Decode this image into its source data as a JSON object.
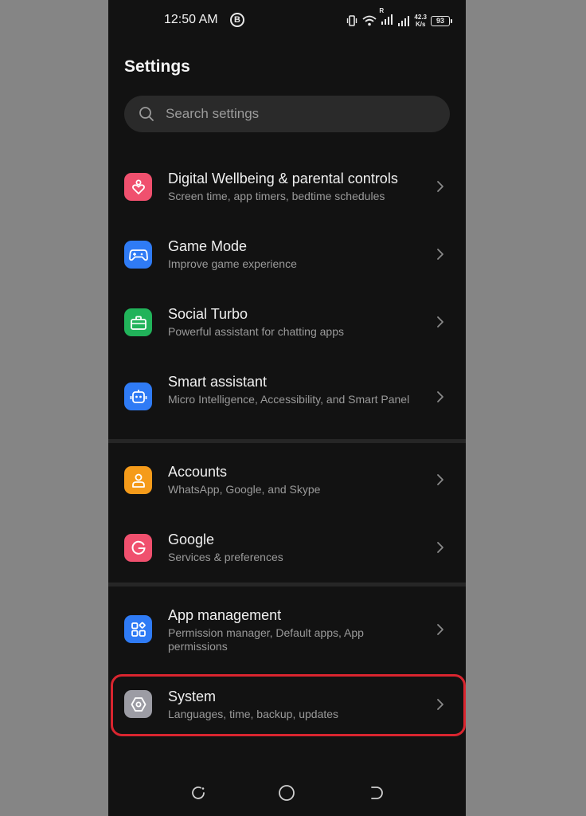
{
  "status_bar": {
    "time": "12:50 AM",
    "b_icon": "B",
    "network_speed_value": "42.3",
    "network_speed_unit": "K/s",
    "battery": "93",
    "roaming": "R"
  },
  "header": {
    "title": "Settings"
  },
  "search": {
    "placeholder": "Search settings"
  },
  "items": [
    {
      "title": "Digital Wellbeing & parental controls",
      "subtitle": "Screen time, app timers, bedtime schedules",
      "icon": "heart-person-icon",
      "color": "#f0506e"
    },
    {
      "title": "Game Mode",
      "subtitle": "Improve game experience",
      "icon": "gamepad-icon",
      "color": "#2f7bf5"
    },
    {
      "title": "Social Turbo",
      "subtitle": "Powerful assistant for chatting apps",
      "icon": "briefcase-icon",
      "color": "#21b35a"
    },
    {
      "title": "Smart assistant",
      "subtitle": "Micro Intelligence, Accessibility, and Smart Panel",
      "icon": "robot-icon",
      "color": "#2f7bf5"
    },
    {
      "title": "Accounts",
      "subtitle": "WhatsApp, Google, and Skype",
      "icon": "person-icon",
      "color": "#f59b1a"
    },
    {
      "title": "Google",
      "subtitle": "Services & preferences",
      "icon": "google-g-icon",
      "color": "#f0506e"
    },
    {
      "title": "App management",
      "subtitle": "Permission manager, Default apps, App permissions",
      "icon": "apps-grid-icon",
      "color": "#2f7bf5"
    },
    {
      "title": "System",
      "subtitle": "Languages, time, backup, updates",
      "icon": "system-hexagon-icon",
      "color": "#9c9ca4"
    }
  ],
  "highlight_color": "#d9252f"
}
